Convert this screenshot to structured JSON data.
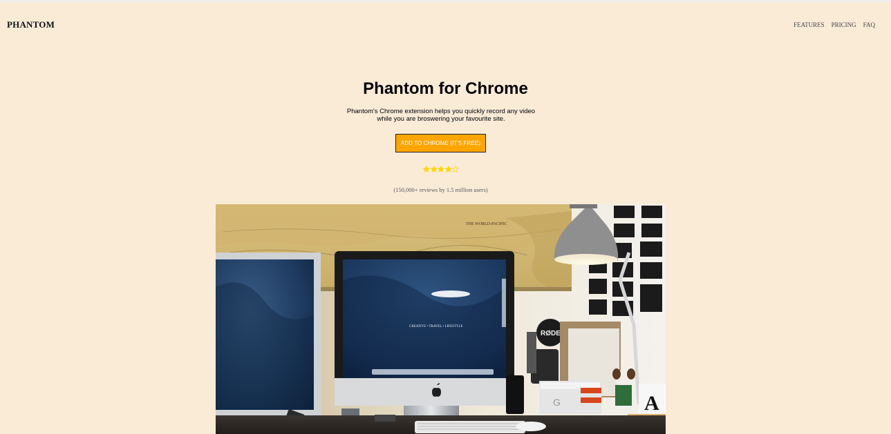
{
  "nav": {
    "logo": "PHANTOM",
    "links": [
      "FEATURES",
      "PRICING",
      "FAQ"
    ]
  },
  "hero": {
    "title": "Phantom for Chrome",
    "subtitle_line1": "Phantom's Chrome extension helps you quickly record any video",
    "subtitle_line2": "while you are broswering your favourite site.",
    "cta_label": "ADD TO CHROME (IT'S FREE)",
    "rating": 4,
    "rating_max": 5,
    "reviews_text": "(150,000+ reviews by 1.5 million users)",
    "image_text": {
      "map_title": "THE WORLD-PACIFIC",
      "screen_text": "CREATIVE • TRAVEL • LIFESTYLE",
      "mic_brand": "RØDE",
      "mug_letter": "A"
    }
  },
  "colors": {
    "background": "#faebd7",
    "cta": "#ffa500",
    "star": "#ffd700"
  },
  "icons": {
    "star_filled": "star-filled-icon",
    "star_empty": "star-empty-icon",
    "apple_logo": "apple-logo-icon"
  }
}
